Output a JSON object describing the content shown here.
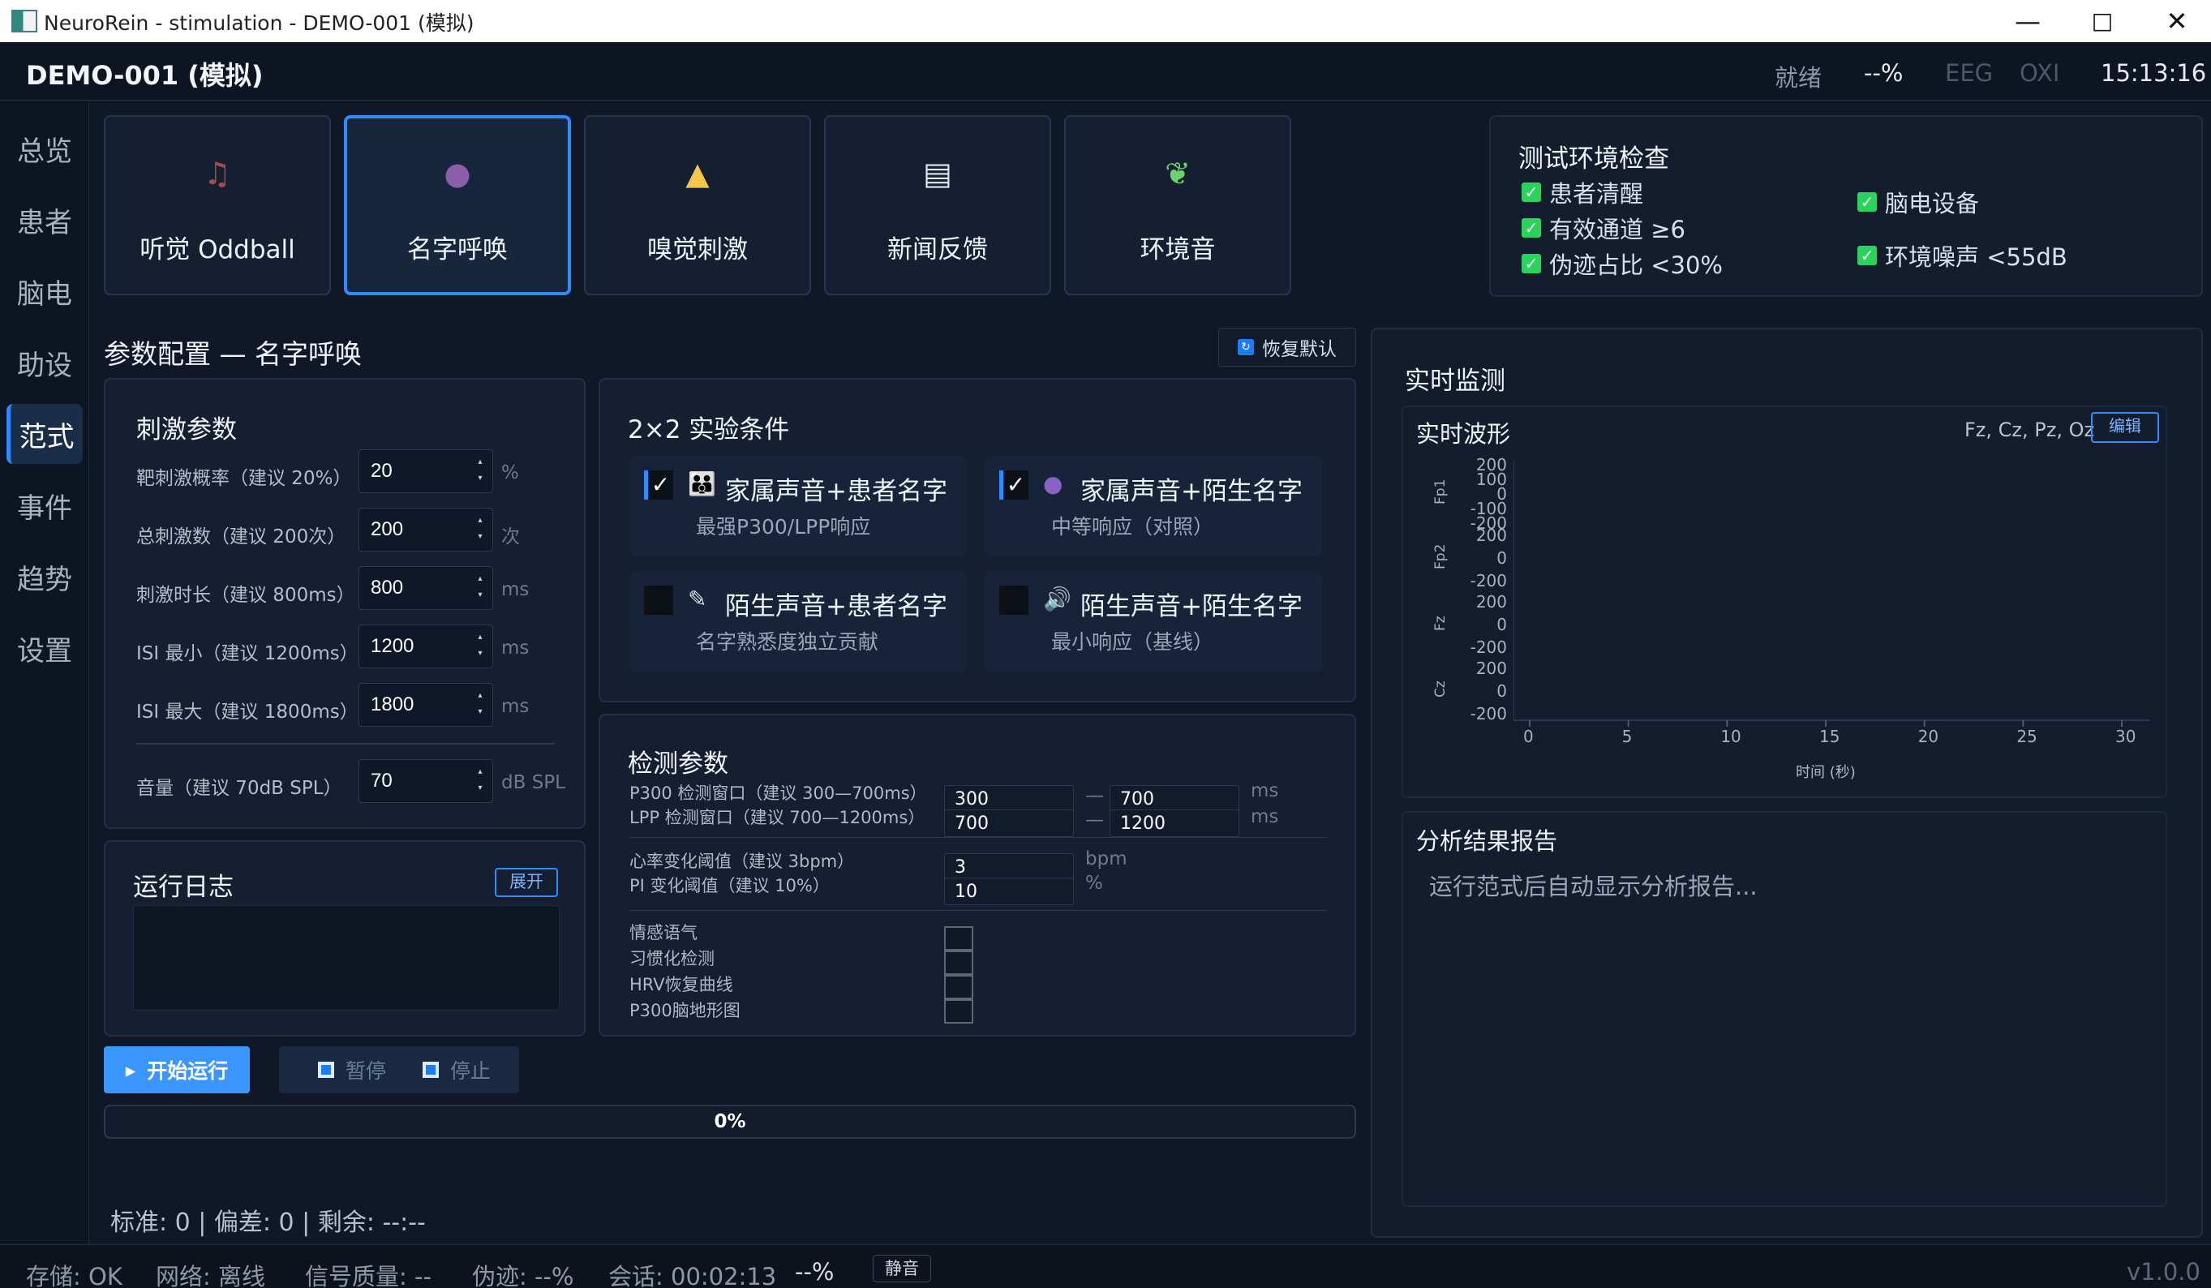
{
  "window": {
    "title": "NeuroRein - stimulation - DEMO-001 (模拟)"
  },
  "header": {
    "title": "DEMO-001 (模拟)",
    "status": "就绪",
    "percent": "--%",
    "eeg": "EEG",
    "oxi": "OXI",
    "time": "15:13:16"
  },
  "sidebar": {
    "items": [
      "总览",
      "患者",
      "脑电",
      "助设",
      "范式",
      "事件",
      "趋势",
      "设置"
    ],
    "active_index": 4
  },
  "tiles": [
    {
      "label": "听觉 Oddball",
      "icon": "music-icon"
    },
    {
      "label": "名字呼唤",
      "icon": "speaking-head-icon"
    },
    {
      "label": "嗅觉刺激",
      "icon": "nose-icon"
    },
    {
      "label": "新闻反馈",
      "icon": "newspaper-icon"
    },
    {
      "label": "环境音",
      "icon": "leaf-icon"
    }
  ],
  "environment": {
    "title": "测试环境检查",
    "checks": [
      "患者清醒",
      "有效通道 ≥6",
      "伪迹占比 <30%",
      "脑电设备",
      "环境噪声 <55dB"
    ],
    "check_mark": "✓",
    "accent": "#2ad35b"
  },
  "parameters": {
    "title": "参数配置 — 名字呼唤",
    "restore_button": "恢复默认",
    "stimulus_title": "刺激参数",
    "stimulus": [
      {
        "label": "靶刺激概率（建议 20%）",
        "value": "20",
        "unit": "%"
      },
      {
        "label": "总刺激数（建议 200次）",
        "value": "200",
        "unit": "次"
      },
      {
        "label": "刺激时长（建议 800ms）",
        "value": "800",
        "unit": "ms"
      },
      {
        "label": "ISI 最小（建议 1200ms）",
        "value": "1200",
        "unit": "ms"
      },
      {
        "label": "ISI 最大（建议 1800ms）",
        "value": "1800",
        "unit": "ms"
      },
      {
        "label": "音量（建议 70dB SPL）",
        "value": "70",
        "unit": "dB SPL"
      }
    ]
  },
  "conditions": {
    "title": "2×2 实验条件",
    "items": [
      {
        "checked": true,
        "check": "✓",
        "icon": "family-icon",
        "title": "家属声音+患者名字",
        "subtitle": "最强P300/LPP响应"
      },
      {
        "checked": true,
        "check": "✓",
        "icon": "person-icon",
        "title": "家属声音+陌生名字",
        "subtitle": "中等响应（对照）"
      },
      {
        "checked": false,
        "check": "",
        "icon": "microphone-icon",
        "title": "陌生声音+患者名字",
        "subtitle": "名字熟悉度独立贡献"
      },
      {
        "checked": false,
        "check": "",
        "icon": "speaker-icon",
        "title": "陌生声音+陌生名字",
        "subtitle": "最小响应（基线）"
      }
    ]
  },
  "detection": {
    "title": "检测参数",
    "rows": [
      {
        "label": "P300 检测窗口（建议 300—700ms）",
        "from": "300",
        "sep": "—",
        "to": "700",
        "unit": "ms"
      },
      {
        "label": "LPP 检测窗口（建议 700—1200ms）",
        "from": "700",
        "sep": "—",
        "to": "1200",
        "unit": "ms"
      },
      {
        "label": "心率变化阈值（建议 3bpm）",
        "value": "3",
        "unit": "bpm"
      },
      {
        "label": "PI 变化阈值（建议 10%）",
        "value": "10",
        "unit": "%"
      }
    ],
    "options": [
      "情感语气",
      "习惯化检测",
      "HRV恢复曲线",
      "P300脑地形图"
    ]
  },
  "log": {
    "title": "运行日志",
    "expand": "展开"
  },
  "actions": {
    "start": "开始运行",
    "pause": "暂停",
    "stop": "停止"
  },
  "progress": {
    "value": 0,
    "label": "0%"
  },
  "stats": {
    "text": "标准: 0 | 偏差: 0 | 剩余: --:--"
  },
  "monitor": {
    "title": "实时监测",
    "wave_title": "实时波形",
    "channels": "Fz, Cz, Pz, Oz",
    "edit": "编辑",
    "report_title": "分析结果报告",
    "report_placeholder": "运行范式后自动显示分析报告..."
  },
  "chart_data": {
    "type": "line",
    "xlabel": "时间 (秒)",
    "ylabel": "",
    "xlim": [
      0,
      30
    ],
    "xticks": [
      "0",
      "5",
      "10",
      "15",
      "20",
      "25",
      "30"
    ],
    "channels": [
      {
        "name": "Fp1",
        "yticks": [
          "200",
          "100",
          "0",
          "-100",
          "-200"
        ]
      },
      {
        "name": "Fp2",
        "yticks": [
          "200",
          "0",
          "-200"
        ]
      },
      {
        "name": "Fz",
        "yticks": [
          "200",
          "0",
          "-200"
        ]
      },
      {
        "name": "Cz",
        "yticks": [
          "200",
          "0",
          "-200"
        ]
      }
    ],
    "series": []
  },
  "footer": {
    "storage": "存储: OK",
    "network": "网络: 离线",
    "signal": "信号质量: --",
    "artifact": "伪迹: --%",
    "session": "会话: 00:02:13",
    "percent": "--%",
    "mute": "静音",
    "version": "v1.0.0"
  }
}
